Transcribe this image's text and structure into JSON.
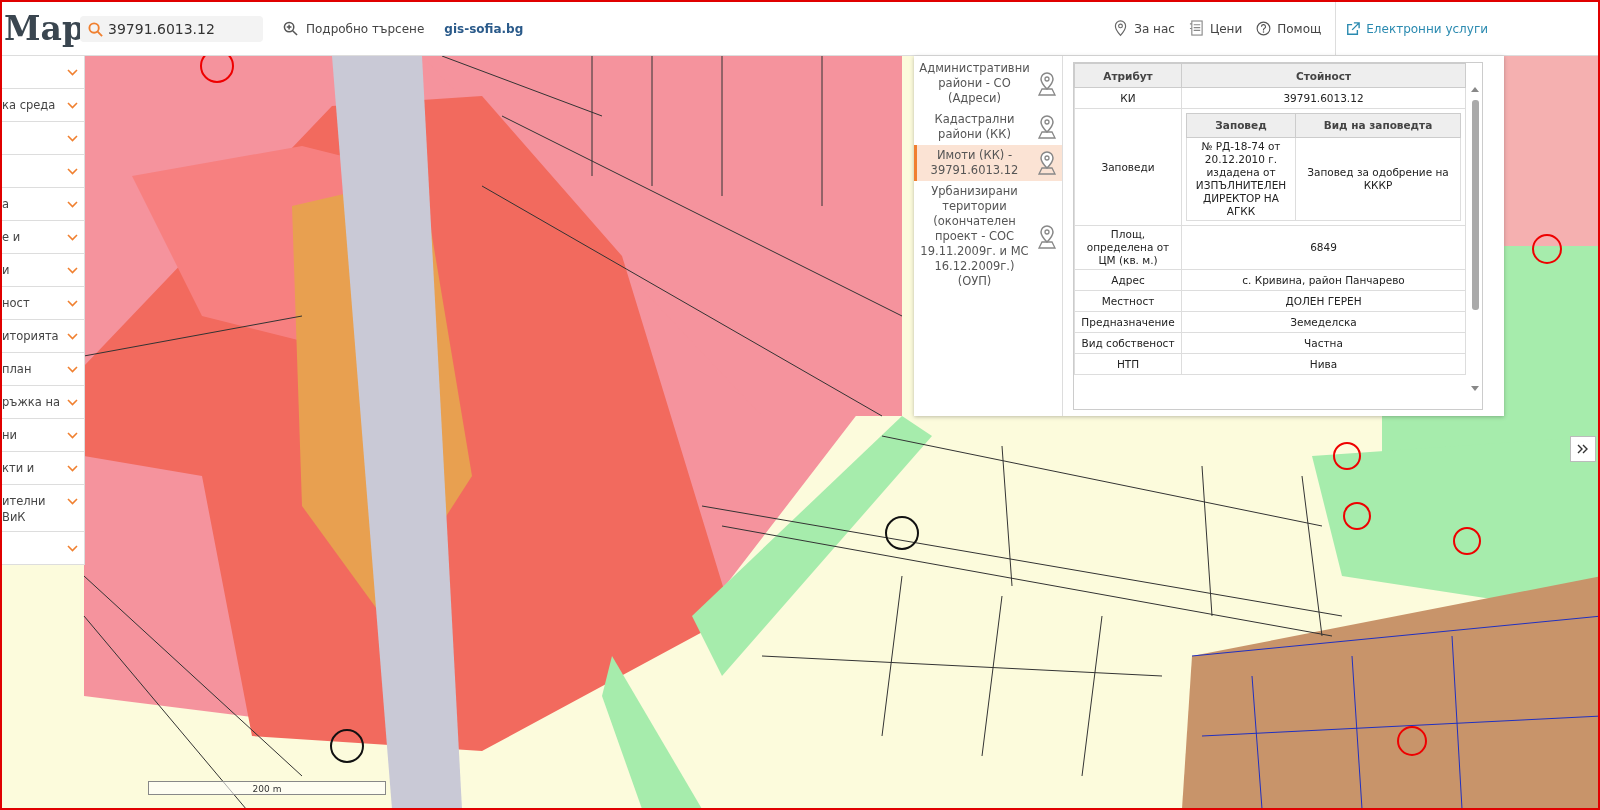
{
  "header": {
    "logo": "Map",
    "search": {
      "value": "39791.6013.12"
    },
    "advanced_search": "Подробно търсене",
    "site_link": "gis-sofia.bg",
    "nav": [
      {
        "kind": "pin",
        "label": "За нас"
      },
      {
        "kind": "list",
        "label": "Цени"
      },
      {
        "kind": "help",
        "label": "Помощ"
      }
    ],
    "services_link": "Електронни услуги"
  },
  "sidebar": {
    "items": [
      {
        "expanded": false
      },
      {
        "label": "ка среда",
        "expanded": false
      },
      {
        "expanded": false
      },
      {
        "expanded": false
      },
      {
        "label": "а",
        "expanded": false
      },
      {
        "label": "е и",
        "expanded": false
      },
      {
        "label": "и",
        "expanded": false
      },
      {
        "label": "ност",
        "expanded": false
      },
      {
        "label": "иторията",
        "expanded": false
      },
      {
        "label": "план",
        "expanded": false
      },
      {
        "label": "ръжка на",
        "expanded": false
      },
      {
        "label": "ни",
        "expanded": false
      },
      {
        "label": "кти и",
        "expanded": false
      },
      {
        "label": "ителни\nВиК",
        "expanded": false
      },
      {
        "expanded": false
      }
    ]
  },
  "info_panel": {
    "layers": [
      {
        "label": "Административни райони - СО (Адреси)",
        "selected": false
      },
      {
        "label": "Кадастрални райони (КК)",
        "selected": false
      },
      {
        "label": "Имоти (КК) - 39791.6013.12",
        "selected": true
      },
      {
        "label": "Урбанизирани територии (окончателен проект - СОС 19.11.2009г. и МС 16.12.2009г.) (ОУП)",
        "selected": false
      }
    ],
    "table": {
      "columns": [
        "Атрибут",
        "Стойност"
      ],
      "rows": [
        {
          "kind": "text",
          "attribute": "КИ",
          "value": "39791.6013.12"
        },
        {
          "kind": "table",
          "attribute": "Заповеди",
          "columns": [
            "Заповед",
            "Вид на заповедта"
          ],
          "rows": [
            [
              "№ РД-18-74 от 20.12.2010 г. издадена от ИЗПЪЛНИТЕЛЕН ДИРЕКТОР НА АГКК",
              "Заповед за одобрение на КККР"
            ]
          ]
        },
        {
          "kind": "text",
          "attribute": "Площ, определена от ЦМ (кв. м.)",
          "value": "6849"
        },
        {
          "kind": "text",
          "attribute": "Адрес",
          "value": "с. Кривина, район Панчарево"
        },
        {
          "kind": "text",
          "attribute": "Местност",
          "value": "ДОЛЕН ГЕРЕН"
        },
        {
          "kind": "text",
          "attribute": "Предназначение",
          "value": "Земеделска"
        },
        {
          "kind": "text",
          "attribute": "Вид собственост",
          "value": "Частна"
        },
        {
          "kind": "text",
          "attribute": "НТП",
          "value": "Нива"
        }
      ]
    }
  },
  "map": {
    "scale_label": "200 m"
  }
}
